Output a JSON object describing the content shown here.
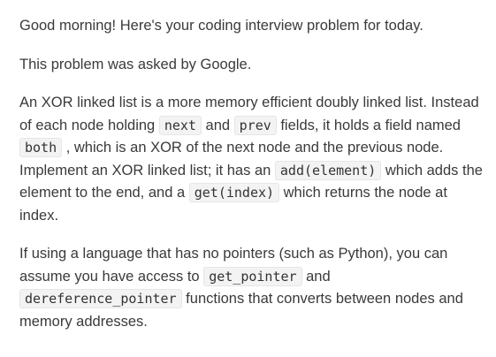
{
  "greeting": "Good morning! Here's your coding interview problem for today.",
  "source": "This problem was asked by Google.",
  "paragraph1": {
    "t1": "An XOR linked list is a more memory efficient doubly linked list. Instead of each node holding ",
    "code_next": "next",
    "t2": " and ",
    "code_prev": "prev",
    "t3": " fields, it holds a field named ",
    "code_both": "both",
    "t4": " , which is an XOR of the next node and the previous node. Implement an XOR linked list; it has an ",
    "code_add": "add(element)",
    "t5": " which adds the element to the end, and a ",
    "code_get": "get(index)",
    "t6": " which returns the node at index."
  },
  "paragraph2": {
    "t1": "If using a language that has no pointers (such as Python), you can assume you have access to ",
    "code_get_pointer": "get_pointer",
    "t2": " and ",
    "code_dereference": "dereference_pointer",
    "t3": " functions that converts between nodes and memory addresses."
  }
}
